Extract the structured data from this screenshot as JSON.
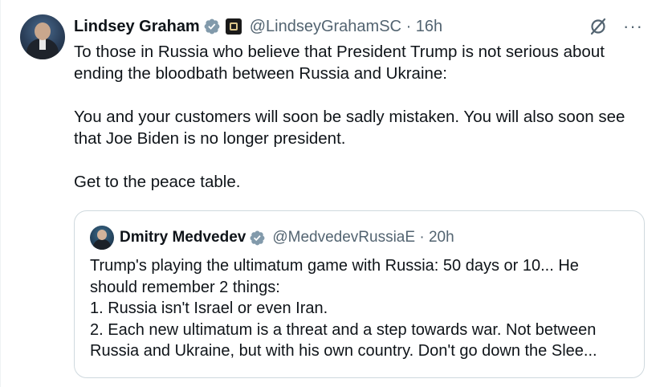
{
  "tweet": {
    "author_name": "Lindsey Graham",
    "author_handle": "@LindseyGrahamSC",
    "separator": "·",
    "time": "16h",
    "paragraphs": [
      "To those in Russia who believe that President Trump is not serious about ending the bloodbath between Russia and Ukraine:",
      "You and your customers will soon be sadly mistaken. You will also soon see that Joe Biden is no longer president.",
      "Get to the peace table."
    ]
  },
  "quote": {
    "author_name": "Dmitry Medvedev",
    "author_handle": "@MedvedevRussiaE",
    "separator": "·",
    "time": "20h",
    "lines": [
      "Trump's playing the ultimatum game with Russia: 50 days or 10... He",
      "should remember 2 things:",
      "1. Russia isn't Israel or even Iran.",
      "2. Each new ultimatum is a threat and a step towards war. Not between",
      "Russia and Ukraine, but with his own country. Don't go down the Slee..."
    ]
  },
  "icons": {
    "verified": "verified-badge-icon",
    "affiliation": "us-senate-affiliation-icon",
    "grok": "grok-icon",
    "more": "more-icon"
  },
  "colors": {
    "text": "#0f1419",
    "secondary": "#536471",
    "verified_blue": "#829aab",
    "border": "#cfd9de"
  }
}
